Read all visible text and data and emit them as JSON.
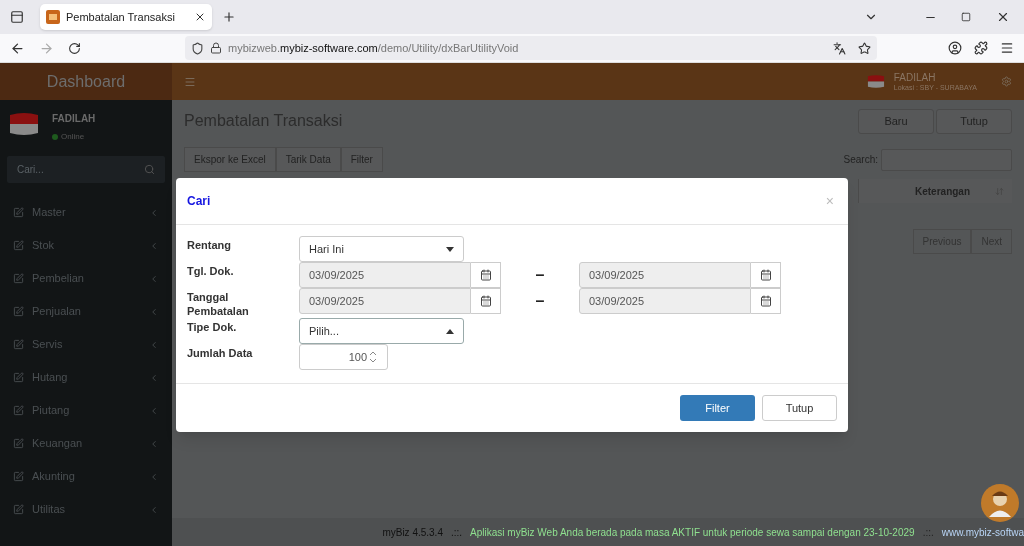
{
  "browser": {
    "tab_title": "Pembatalan Transaksi",
    "url": {
      "subdomain": "mybizweb.",
      "domain": "mybiz-software.com",
      "path": "/demo/Utility/dxBarUtilityVoid"
    }
  },
  "header": {
    "brand": "Dashboard",
    "user_name": "FADILAH",
    "location": "Lokasi : SBY - SURABAYA"
  },
  "sidebar": {
    "user_name": "FADILAH",
    "status": "Online",
    "search": {
      "placeholder": "Cari..."
    },
    "items": [
      {
        "label": "Master"
      },
      {
        "label": "Stok"
      },
      {
        "label": "Pembelian"
      },
      {
        "label": "Penjualan"
      },
      {
        "label": "Servis"
      },
      {
        "label": "Hutang"
      },
      {
        "label": "Piutang"
      },
      {
        "label": "Keuangan"
      },
      {
        "label": "Akunting"
      },
      {
        "label": "Utilitas"
      }
    ]
  },
  "page": {
    "title": "Pembatalan Transaksi",
    "actions": [
      "Baru",
      "Tutup"
    ],
    "toolbar": [
      "Ekspor ke Excel",
      "Tarik Data",
      "Filter"
    ],
    "search_label": "Search:",
    "table": {
      "columns": [
        "Keterangan"
      ]
    },
    "pager": [
      "Previous",
      "Next"
    ]
  },
  "modal": {
    "title": "Cari",
    "close": "×",
    "fields": [
      {
        "label": "Rentang",
        "kind": "select",
        "value": "Hari Ini",
        "open": false
      },
      {
        "label": "Tgl. Dok.",
        "kind": "daterange",
        "from": "03/09/2025",
        "separator": "–",
        "to": "03/09/2025"
      },
      {
        "label": "Tanggal Pembatalan",
        "kind": "daterange",
        "from": "03/09/2025",
        "separator": "–",
        "to": "03/09/2025"
      },
      {
        "label": "Tipe Dok.",
        "kind": "select",
        "value": "Pilih...",
        "open": true
      },
      {
        "label": "Jumlah Data",
        "kind": "number",
        "value": "100"
      }
    ],
    "buttons": [
      {
        "label": "Filter",
        "kind": "primary"
      },
      {
        "label": "Tutup",
        "kind": "default"
      }
    ]
  },
  "footer": {
    "version": "myBiz 4.5.3.4",
    "separator_1": ".::.",
    "message": "Aplikasi myBiz Web Anda berada pada masa AKTIF untuk periode sewa sampai dengan 23-10-2029",
    "separator_2": ".::.",
    "website": "www.mybiz-softwa"
  }
}
